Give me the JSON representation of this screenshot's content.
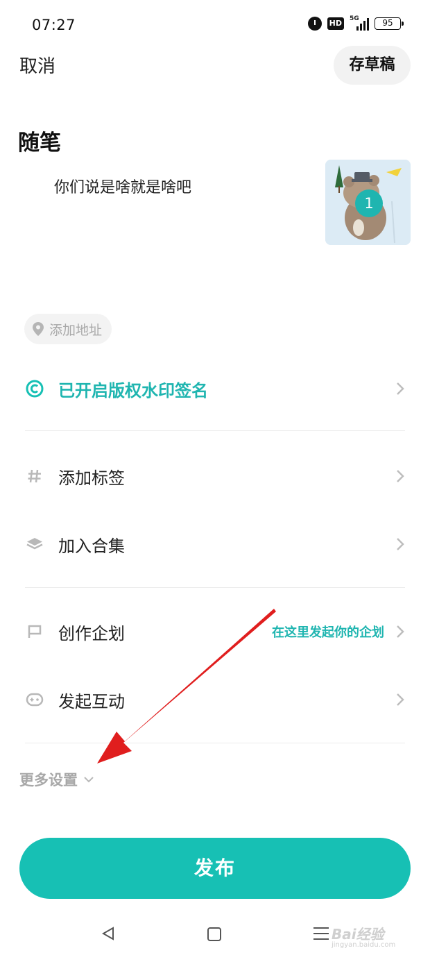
{
  "status_bar": {
    "time": "07:27",
    "hd": "HD",
    "network": "5G",
    "battery": "95"
  },
  "header": {
    "cancel_label": "取消",
    "draft_label": "存草稿"
  },
  "post": {
    "title": "随笔",
    "body": "你们说是啥就是啥吧",
    "image_count": "1"
  },
  "location": {
    "placeholder": "添加地址"
  },
  "settings": {
    "copyright_label": "已开启版权水印签名",
    "tag_label": "添加标签",
    "collection_label": "加入合集",
    "plan_label": "创作企划",
    "plan_hint": "在这里发起你的企划",
    "interact_label": "发起互动"
  },
  "more_settings_label": "更多设置",
  "publish_label": "发布",
  "watermark": {
    "brand": "Bai经验",
    "url": "jingyan.baidu.com"
  },
  "colors": {
    "accent": "#17c0b4",
    "annotation_arrow": "#e01e1e"
  }
}
